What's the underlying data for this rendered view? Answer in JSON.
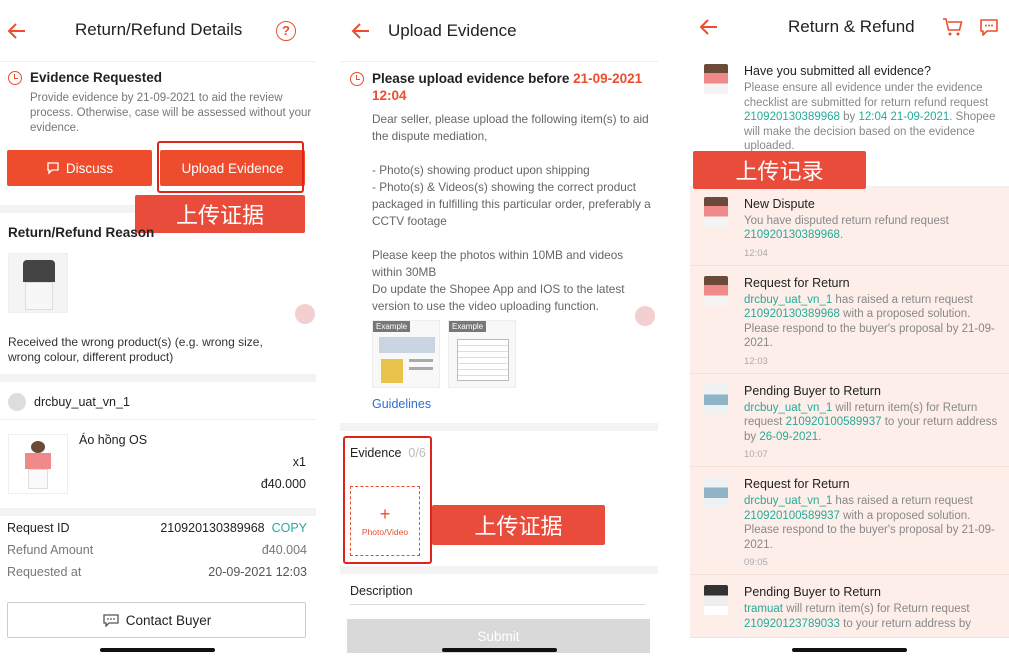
{
  "panel1": {
    "title": "Return/Refund Details",
    "help_glyph": "?",
    "evidence_title": "Evidence Requested",
    "evidence_desc": "Provide evidence by 21-09-2021 to aid the review process. Otherwise, case will be assessed without your evidence.",
    "discuss_label": "Discuss",
    "upload_label": "Upload Evidence",
    "annotation": "上传证据",
    "reason_title": "Return/Refund Reason",
    "reason_text": "Received the wrong product(s) (e.g. wrong size, wrong colour, different product)",
    "buyer_name": "drcbuy_uat_vn_1",
    "product_name": "Áo hồng OS",
    "product_qty": "x1",
    "product_price": "đ40.000",
    "request_id_label": "Request ID",
    "request_id_value": "210920130389968",
    "copy_label": "COPY",
    "refund_amount_label": "Refund Amount",
    "refund_amount_value": "đ40.004",
    "requested_at_label": "Requested at",
    "requested_at_value": "20-09-2021 12:03",
    "contact_label": "Contact Buyer"
  },
  "panel2": {
    "title": "Upload Evidence",
    "deadline_prefix": "Please upload evidence before ",
    "deadline_date": "21-09-2021",
    "deadline_time": "12:04",
    "body_lines": [
      "Dear seller, please upload the following item(s) to aid the dispute mediation,",
      "- Photo(s) showing product upon shipping",
      "- Photo(s) & Videos(s) showing the correct product packaged in fulfilling this particular order, preferably a CCTV footage",
      "Please keep the photos within 10MB and videos within 30MB",
      "Do update the Shopee App and IOS to the latest version to use the video uploading function."
    ],
    "example_label": "Example",
    "guidelines_label": "Guidelines",
    "evidence_label": "Evidence",
    "evidence_count": "0/6",
    "plus_glyph": "+",
    "photo_video_label": "Photo/Video",
    "annotation": "上传证据",
    "description_label": "Description",
    "submit_label": "Submit"
  },
  "panel3": {
    "title": "Return & Refund",
    "annotation": "上传记录",
    "messages": [
      {
        "title": "Have you submitted all evidence?",
        "parts": [
          {
            "t": "Please ensure all evidence under the evidence checklist are submitted for return refund request ",
            "c": "muted"
          },
          {
            "t": "210920130389968",
            "c": "green"
          },
          {
            "t": " by ",
            "c": "muted"
          },
          {
            "t": "12:04 21-09-2021",
            "c": "green"
          },
          {
            "t": ". Shopee will make the decision based on the evidence uploaded.",
            "c": "muted"
          }
        ],
        "time": ""
      },
      {
        "title": "New Dispute",
        "parts": [
          {
            "t": "You have disputed return refund request ",
            "c": "muted"
          },
          {
            "t": "210920130389968",
            "c": "green"
          },
          {
            "t": ".",
            "c": "muted"
          }
        ],
        "time": "12:04"
      },
      {
        "title": "Request for Return",
        "parts": [
          {
            "t": "drcbuy_uat_vn_1",
            "c": "green"
          },
          {
            "t": " has raised a return request ",
            "c": "muted"
          },
          {
            "t": "210920130389968",
            "c": "green"
          },
          {
            "t": " with a proposed solution. Please respond to the buyer's proposal by 21-09-2021.",
            "c": "muted"
          }
        ],
        "time": "12:03"
      },
      {
        "title": "Pending Buyer to Return",
        "parts": [
          {
            "t": "drcbuy_uat_vn_1",
            "c": "green"
          },
          {
            "t": " will return item(s) for Return request ",
            "c": "muted"
          },
          {
            "t": "210920100589937",
            "c": "green"
          },
          {
            "t": " to your return address by ",
            "c": "muted"
          },
          {
            "t": "26-09-2021",
            "c": "green"
          },
          {
            "t": ".",
            "c": "muted"
          }
        ],
        "time": "10:07"
      },
      {
        "title": "Request for Return",
        "parts": [
          {
            "t": "drcbuy_uat_vn_1",
            "c": "green"
          },
          {
            "t": " has raised a return request ",
            "c": "muted"
          },
          {
            "t": "210920100589937",
            "c": "green"
          },
          {
            "t": " with a proposed solution. Please respond to the buyer's proposal by 21-09-2021.",
            "c": "muted"
          }
        ],
        "time": "09:05"
      },
      {
        "title": "Pending Buyer to Return",
        "parts": [
          {
            "t": "tramuat",
            "c": "green"
          },
          {
            "t": " will return item(s) for Return request ",
            "c": "muted"
          },
          {
            "t": "210920123789033",
            "c": "green"
          },
          {
            "t": " to your return address by",
            "c": "muted"
          }
        ],
        "time": ""
      }
    ]
  },
  "colors": {
    "accent": "#ee4d2d",
    "link": "#26aa99",
    "annotation": "#e94c3b"
  }
}
